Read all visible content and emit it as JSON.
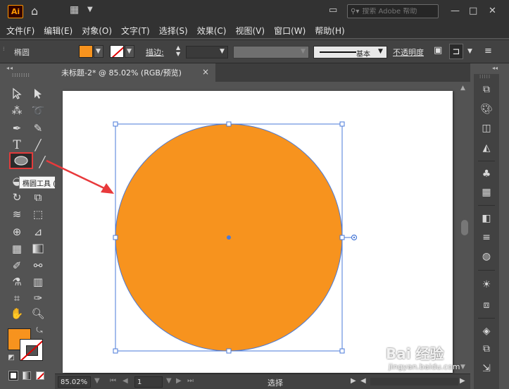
{
  "app": {
    "logo_text": "Ai",
    "search_placeholder": "搜索 Adobe 帮助"
  },
  "menu": {
    "items": [
      "文件(F)",
      "编辑(E)",
      "对象(O)",
      "文字(T)",
      "选择(S)",
      "效果(C)",
      "视图(V)",
      "窗口(W)",
      "帮助(H)"
    ]
  },
  "control_bar": {
    "tool_name": "椭圆",
    "stroke_label": "描边",
    "brush_label": "基本",
    "opacity_label": "不透明度"
  },
  "document": {
    "tab_title": "未标题-2* @ 85.02% (RGB/预览)",
    "close_glyph": "×"
  },
  "artwork": {
    "fill_color": "#f7931e",
    "stroke_color": "#4a7ad8",
    "selection_color": "#4a7ad8"
  },
  "toolbar": {
    "tooltip": "椭圆工具 (L)",
    "fill_color": "#f7931e",
    "highlight_color": "#e23b3b"
  },
  "status_bar": {
    "zoom": "85.02%",
    "page": "1",
    "status_text": "选择"
  },
  "watermark": {
    "main": "Bai 经验",
    "sub": "jingyan.baidu.com"
  }
}
